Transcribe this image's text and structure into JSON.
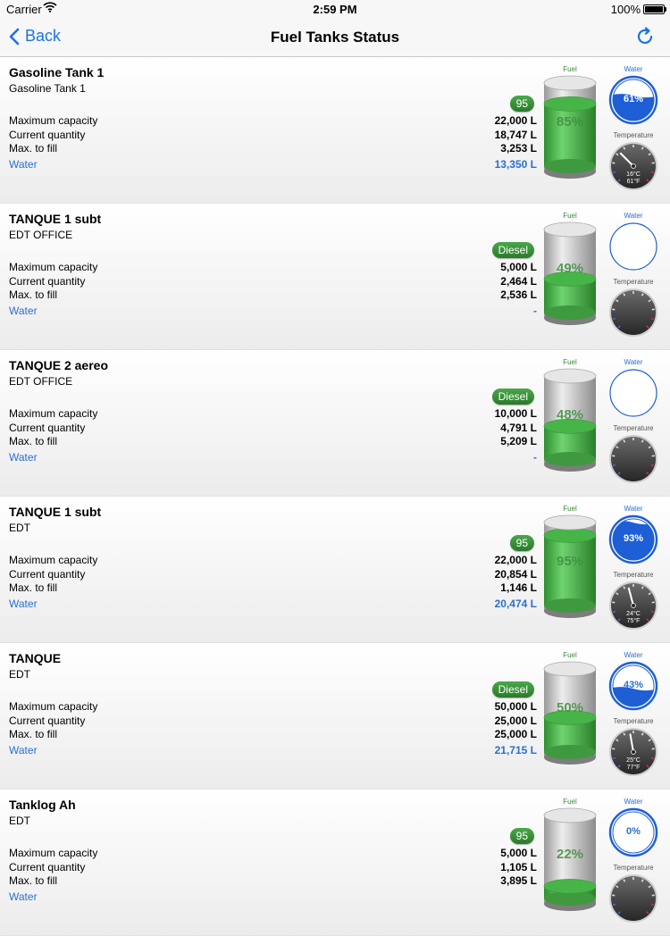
{
  "status_bar": {
    "carrier": "Carrier",
    "time": "2:59 PM",
    "battery": "100%"
  },
  "nav": {
    "back_label": "Back",
    "title": "Fuel Tanks Status"
  },
  "labels": {
    "max_capacity": "Maximum capacity",
    "current_quantity": "Current quantity",
    "max_to_fill": "Max. to fill",
    "water": "Water",
    "fuel_caption": "Fuel",
    "water_caption": "Water",
    "temperature_caption": "Temperature"
  },
  "tanks": [
    {
      "title": "Gasoline Tank 1",
      "subtitle": "Gasoline Tank 1",
      "badge": "95",
      "max_capacity": "22,000 L",
      "current_quantity": "18,747 L",
      "max_to_fill": "3,253 L",
      "water": "13,350 L",
      "fuel_percent": "85%",
      "fuel_level": 0.85,
      "water_percent": "61%",
      "water_level": 0.61,
      "temp_c": "16°C",
      "temp_f": "61°F",
      "needle_angle": -45
    },
    {
      "title": "TANQUE 1 subt",
      "subtitle": "EDT OFFICE",
      "badge": "Diesel",
      "max_capacity": "5,000 L",
      "current_quantity": "2,464 L",
      "max_to_fill": "2,536 L",
      "water": "-",
      "fuel_percent": "49%",
      "fuel_level": 0.49,
      "water_percent": "",
      "water_level": 0,
      "temp_c": "",
      "temp_f": "",
      "needle_angle": null
    },
    {
      "title": "TANQUE 2 aereo",
      "subtitle": "EDT OFFICE",
      "badge": "Diesel",
      "max_capacity": "10,000 L",
      "current_quantity": "4,791 L",
      "max_to_fill": "5,209 L",
      "water": "-",
      "fuel_percent": "48%",
      "fuel_level": 0.48,
      "water_percent": "",
      "water_level": 0,
      "temp_c": "",
      "temp_f": "",
      "needle_angle": null
    },
    {
      "title": "TANQUE 1 subt",
      "subtitle": "EDT",
      "badge": "95",
      "max_capacity": "22,000 L",
      "current_quantity": "20,854 L",
      "max_to_fill": "1,146 L",
      "water": "20,474 L",
      "fuel_percent": "95%",
      "fuel_level": 0.95,
      "water_percent": "93%",
      "water_level": 0.93,
      "temp_c": "24°C",
      "temp_f": "75°F",
      "needle_angle": -15
    },
    {
      "title": "TANQUE",
      "subtitle": "EDT",
      "badge": "Diesel",
      "max_capacity": "50,000 L",
      "current_quantity": "25,000 L",
      "max_to_fill": "25,000 L",
      "water": "21,715 L",
      "fuel_percent": "50%",
      "fuel_level": 0.5,
      "water_percent": "43%",
      "water_level": 0.43,
      "temp_c": "25°C",
      "temp_f": "77°F",
      "needle_angle": -10
    },
    {
      "title": "Tanklog Ah",
      "subtitle": "EDT",
      "badge": "95",
      "max_capacity": "5,000 L",
      "current_quantity": "1,105 L",
      "max_to_fill": "3,895 L",
      "water": "",
      "fuel_percent": "22%",
      "fuel_level": 0.22,
      "water_percent": "0%",
      "water_level": 0,
      "temp_c": "",
      "temp_f": "",
      "needle_angle": null
    }
  ],
  "colors": {
    "accent": "#1a73e8",
    "fuel_green": "#3cb043",
    "water_blue": "#1e5fd6",
    "water_label": "#2a6fd1"
  }
}
